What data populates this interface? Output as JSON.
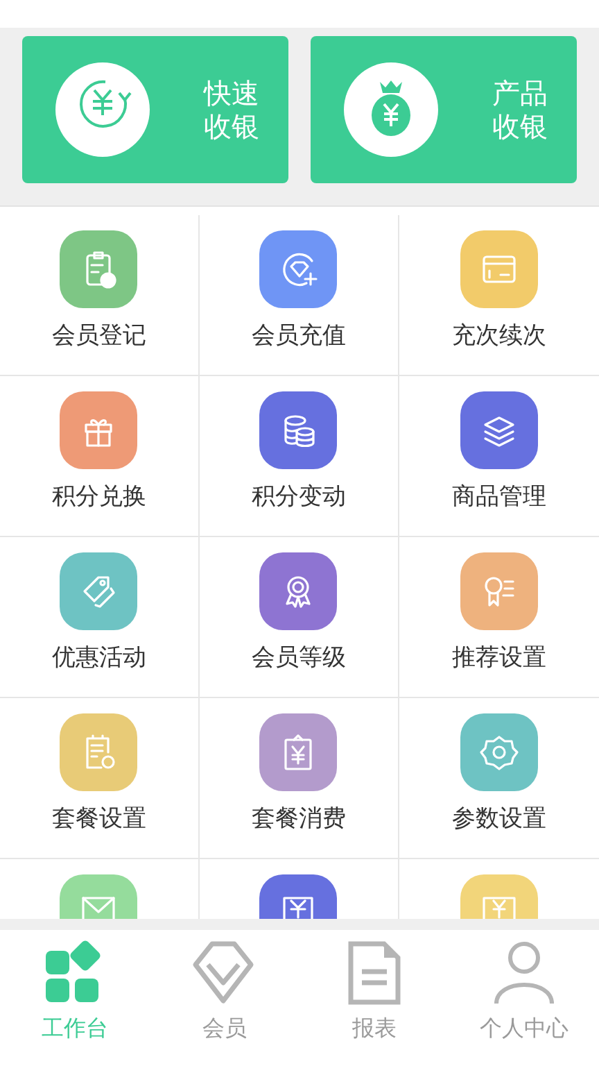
{
  "quick_cards": [
    {
      "label": "快速收银"
    },
    {
      "label": "产品收银"
    }
  ],
  "menu_items": [
    {
      "label": "会员登记",
      "color": "#7ec685"
    },
    {
      "label": "会员充值",
      "color": "#6f95f5"
    },
    {
      "label": "充次续次",
      "color": "#f2cb6a"
    },
    {
      "label": "积分兑换",
      "color": "#ee9a76"
    },
    {
      "label": "积分变动",
      "color": "#6670df"
    },
    {
      "label": "商品管理",
      "color": "#6670df"
    },
    {
      "label": "优惠活动",
      "color": "#6ec3c3"
    },
    {
      "label": "会员等级",
      "color": "#8e74d2"
    },
    {
      "label": "推荐设置",
      "color": "#eeb27e"
    },
    {
      "label": "套餐设置",
      "color": "#e8cb77"
    },
    {
      "label": "套餐消费",
      "color": "#b39bcc"
    },
    {
      "label": "参数设置",
      "color": "#6ec3c3"
    },
    {
      "color": "#95dc9c"
    },
    {
      "color": "#6670df"
    },
    {
      "color": "#f2d57a"
    }
  ],
  "tab_bar": [
    {
      "label": "工作台",
      "selected": true
    },
    {
      "label": "会员",
      "selected": false
    },
    {
      "label": "报表",
      "selected": false
    },
    {
      "label": "个人中心",
      "selected": false
    }
  ]
}
